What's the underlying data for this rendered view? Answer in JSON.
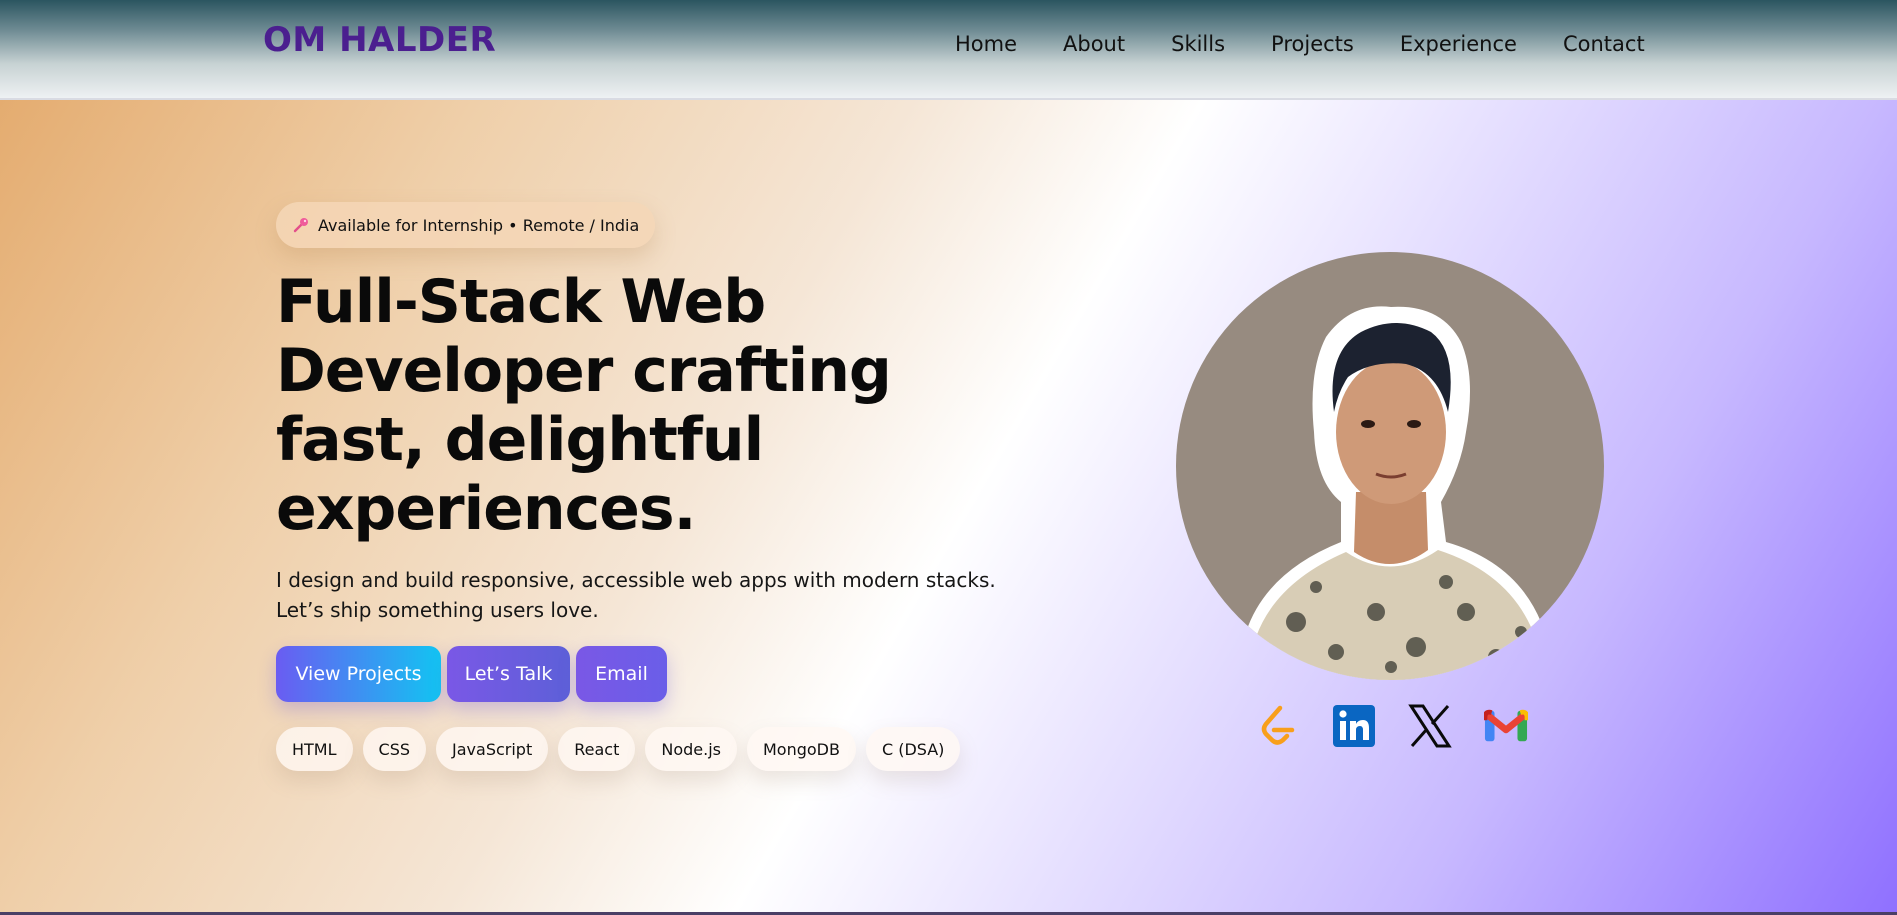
{
  "brand": "OM HALDER",
  "nav": {
    "items": [
      "Home",
      "About",
      "Skills",
      "Projects",
      "Experience",
      "Contact"
    ]
  },
  "hero": {
    "badge": {
      "icon": "pin-icon",
      "text": "Available for Internship • Remote / India"
    },
    "headline": "Full-Stack Web Developer crafting fast, delightful experiences.",
    "subtext": "I design and build responsive, accessible web apps with modern stacks. Let’s ship something users love.",
    "buttons": {
      "view_projects": "View Projects",
      "lets_talk": "Let’s Talk",
      "email": "Email"
    },
    "tags": [
      "HTML",
      "CSS",
      "JavaScript",
      "React",
      "Node.js",
      "MongoDB",
      "C (DSA)"
    ]
  },
  "socials": [
    "leetcode-icon",
    "linkedin-icon",
    "x-icon",
    "gmail-icon"
  ],
  "colors": {
    "brand": "#4b1f8f",
    "accent_cyan": "#12c4f2",
    "accent_purple": "#6a5cf2",
    "linkedin": "#0a66c2",
    "leetcode": "#f89f1b"
  }
}
